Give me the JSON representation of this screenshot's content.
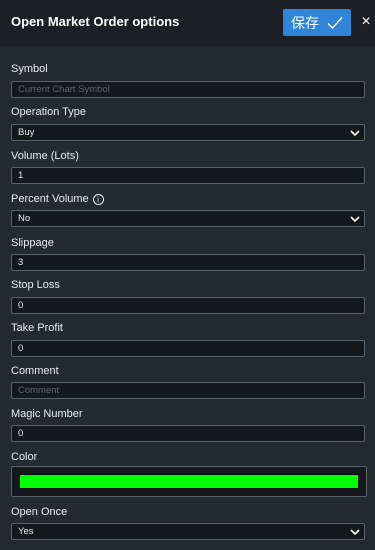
{
  "header": {
    "title": "Open Market Order options",
    "save_label": "保存",
    "close_glyph": "×"
  },
  "form": {
    "symbol": {
      "label": "Symbol",
      "placeholder": "Current Chart Symbol",
      "value": ""
    },
    "operation_type": {
      "label": "Operation Type",
      "value": "Buy"
    },
    "volume": {
      "label": "Volume (Lots)",
      "value": "1"
    },
    "percent_volume": {
      "label": "Percent Volume",
      "value": "No",
      "info_glyph": "i"
    },
    "slippage": {
      "label": "Slippage",
      "value": "3"
    },
    "stop_loss": {
      "label": "Stop Loss",
      "value": "0"
    },
    "take_profit": {
      "label": "Take Profit",
      "value": "0"
    },
    "comment": {
      "label": "Comment",
      "placeholder": "Comment",
      "value": ""
    },
    "magic_number": {
      "label": "Magic Number",
      "value": "0"
    },
    "color": {
      "label": "Color",
      "value": "#00ff00"
    },
    "open_once": {
      "label": "Open Once",
      "value": "Yes"
    }
  },
  "colors": {
    "accent": "#2f86d8",
    "background": "#252a31",
    "header_background": "#1c2026"
  },
  "icons": {
    "save": "check-icon",
    "close": "close-icon",
    "select": "chevron-down-icon",
    "info": "info-icon"
  }
}
